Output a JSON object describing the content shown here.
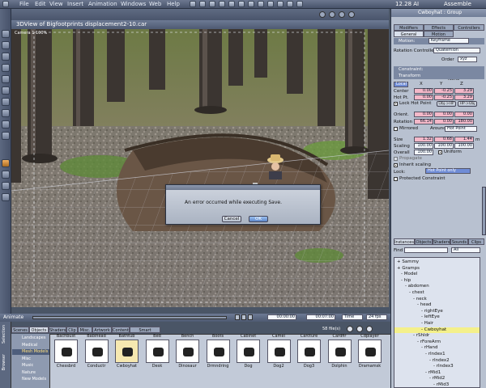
{
  "menubar": {
    "items": [
      "File",
      "Edit",
      "View",
      "Insert",
      "Animation",
      "Windows",
      "Web",
      "Help"
    ],
    "clock": "12.28 AI",
    "mode": "Assemble"
  },
  "viewport": {
    "title": "3DView of Bigfootprints displacement2-10.car",
    "camera_label": "Camera 1 100%"
  },
  "dialog": {
    "message": "An error occurred while executing Save.",
    "cancel_label": "Cancel",
    "ok_label": "OK"
  },
  "panel": {
    "title": "Cwboyhat : Group",
    "tabs_row1": [
      "Modifiers",
      "Effects",
      "Controllers"
    ],
    "tabs_row2": [
      "General",
      "Motion"
    ],
    "motion_header": "Motion:",
    "motion_value": "Keyframe",
    "rotation_controller_label": "Rotation Controller",
    "rotation_controller_value": "Quaternion",
    "order_label": "Order",
    "order_value": "xyz",
    "constraint_header": "Constraint:",
    "constraint_value": "None",
    "transform_header": "Transform",
    "local_label": "Local",
    "axis_labels": [
      "X",
      "Y",
      "Z"
    ],
    "center_label": "Center",
    "center": [
      "0.00",
      "-0.25",
      "3.29"
    ],
    "hotpt_label": "Hot Pt.",
    "hotpt": [
      "0.00",
      "-0.25",
      "3.29"
    ],
    "lock_hotpoint_label": "Lock Hot Point",
    "obj_hp_label": "Obj->HP",
    "hp_obj_label": "HP->Obj",
    "orient_label": "Orient.",
    "orient": [
      "0.00",
      "0.00",
      "0.00"
    ],
    "rotation_label": "Rotation",
    "rotation": [
      "66.14",
      "0.00",
      "180.00"
    ],
    "mirrored_label": "Mirrored",
    "around_label": "Around",
    "around_value": "Hot Point",
    "size_label": "Size",
    "size": [
      "1.32",
      "0.68",
      "1.44"
    ],
    "size_unit": "m",
    "scaling_label": "Scaling",
    "scaling": [
      "100.00",
      "100.00",
      "100.00"
    ],
    "overall_label": "Overall",
    "overall": "100.00",
    "uniform_label": "Uniform",
    "propagate_label": "Propagate",
    "inherit_scaling_label": "Inherit scaling",
    "lock_label": "Lock:",
    "lock_value": "Hot Point only",
    "protected_label": "Protected Constraint"
  },
  "bottom_tabs": [
    "Instances",
    "Objects",
    "Shaders",
    "Sounds",
    "Clips"
  ],
  "find": {
    "label": "Find",
    "filter": "All"
  },
  "tree": [
    {
      "label": "Sammy",
      "indent": 0
    },
    {
      "label": "Gramps",
      "indent": 0
    },
    {
      "label": "Model",
      "indent": 1
    },
    {
      "label": "hip",
      "indent": 1
    },
    {
      "label": "abdomen",
      "indent": 2
    },
    {
      "label": "chest",
      "indent": 3
    },
    {
      "label": "neck",
      "indent": 4
    },
    {
      "label": "head",
      "indent": 5
    },
    {
      "label": "rightEye",
      "indent": 6
    },
    {
      "label": "leftEye",
      "indent": 6
    },
    {
      "label": "Hair",
      "indent": 6
    },
    {
      "label": "Cwboyhat",
      "indent": 6,
      "highlight": true
    },
    {
      "label": "rShldr",
      "indent": 4
    },
    {
      "label": "rForeArm",
      "indent": 5
    },
    {
      "label": "rHand",
      "indent": 6
    },
    {
      "label": "rIndex1",
      "indent": 7
    },
    {
      "label": "rIndex2",
      "indent": 8
    },
    {
      "label": "rIndex3",
      "indent": 9
    },
    {
      "label": "rMid1",
      "indent": 7
    },
    {
      "label": "rMid2",
      "indent": 8
    },
    {
      "label": "rMid3",
      "indent": 9
    }
  ],
  "animbar": {
    "label": "Animate",
    "time1": "00:00:00",
    "time2": "00:07:00",
    "mode": "Time",
    "fps": "24 fps"
  },
  "library": {
    "tabs": [
      "Scenes",
      "Objects",
      "Shaders",
      "Clip",
      "Misc.",
      "Artwork",
      "Content",
      "Smart Content"
    ],
    "count": "58 file(s)",
    "categories": [
      "Landscapes",
      "Medical",
      "Mesh Models",
      "Misc",
      "Music",
      "Nature",
      "New Models"
    ],
    "selected_category": "Mesh Models",
    "side_tabs": [
      "Browser",
      "Selection"
    ],
    "thumbs": [
      {
        "top": "Bachbust",
        "name": "Chessbrd"
      },
      {
        "top": "Babihead",
        "name": "Conductr"
      },
      {
        "top": "Bathtub",
        "name": "Cwboyhat"
      },
      {
        "top": "Bed",
        "name": "Desk"
      },
      {
        "top": "Bench",
        "name": "Dinosaur"
      },
      {
        "top": "Boots",
        "name": "Drmndring"
      },
      {
        "top": "Cabinet",
        "name": "Dog"
      },
      {
        "top": "Camel",
        "name": "Dog2"
      },
      {
        "top": "Carcture",
        "name": "Dog3"
      },
      {
        "top": "Cardfir",
        "name": "Dolphin"
      },
      {
        "top": "Cdplayer",
        "name": "Dramamsk"
      }
    ]
  },
  "colors": {
    "accent": "#6f8cd6",
    "highlight": "#f4f08a",
    "field_pink": "#f4b8c8"
  }
}
